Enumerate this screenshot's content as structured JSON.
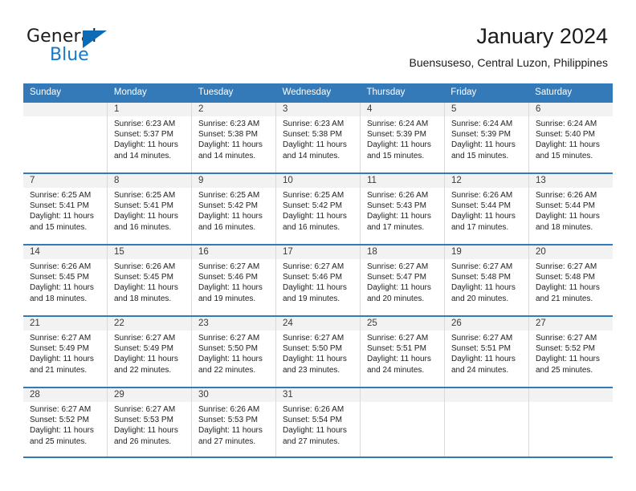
{
  "logo": {
    "word1": "General",
    "word2": "Blue",
    "triangle_color": "#0b6cb5",
    "blue_color": "#1878c8"
  },
  "header": {
    "title": "January 2024",
    "subtitle": "Buensuseso, Central Luzon, Philippines"
  },
  "theme": {
    "header_band": "#357ab8",
    "daynum_band": "#f2f2f2",
    "grid_line": "#d9d9d9"
  },
  "weekdays": [
    "Sunday",
    "Monday",
    "Tuesday",
    "Wednesday",
    "Thursday",
    "Friday",
    "Saturday"
  ],
  "weeks": [
    [
      {
        "day": ""
      },
      {
        "day": "1",
        "sunrise": "Sunrise: 6:23 AM",
        "sunset": "Sunset: 5:37 PM",
        "daylight1": "Daylight: 11 hours",
        "daylight2": "and 14 minutes."
      },
      {
        "day": "2",
        "sunrise": "Sunrise: 6:23 AM",
        "sunset": "Sunset: 5:38 PM",
        "daylight1": "Daylight: 11 hours",
        "daylight2": "and 14 minutes."
      },
      {
        "day": "3",
        "sunrise": "Sunrise: 6:23 AM",
        "sunset": "Sunset: 5:38 PM",
        "daylight1": "Daylight: 11 hours",
        "daylight2": "and 14 minutes."
      },
      {
        "day": "4",
        "sunrise": "Sunrise: 6:24 AM",
        "sunset": "Sunset: 5:39 PM",
        "daylight1": "Daylight: 11 hours",
        "daylight2": "and 15 minutes."
      },
      {
        "day": "5",
        "sunrise": "Sunrise: 6:24 AM",
        "sunset": "Sunset: 5:39 PM",
        "daylight1": "Daylight: 11 hours",
        "daylight2": "and 15 minutes."
      },
      {
        "day": "6",
        "sunrise": "Sunrise: 6:24 AM",
        "sunset": "Sunset: 5:40 PM",
        "daylight1": "Daylight: 11 hours",
        "daylight2": "and 15 minutes."
      }
    ],
    [
      {
        "day": "7",
        "sunrise": "Sunrise: 6:25 AM",
        "sunset": "Sunset: 5:41 PM",
        "daylight1": "Daylight: 11 hours",
        "daylight2": "and 15 minutes."
      },
      {
        "day": "8",
        "sunrise": "Sunrise: 6:25 AM",
        "sunset": "Sunset: 5:41 PM",
        "daylight1": "Daylight: 11 hours",
        "daylight2": "and 16 minutes."
      },
      {
        "day": "9",
        "sunrise": "Sunrise: 6:25 AM",
        "sunset": "Sunset: 5:42 PM",
        "daylight1": "Daylight: 11 hours",
        "daylight2": "and 16 minutes."
      },
      {
        "day": "10",
        "sunrise": "Sunrise: 6:25 AM",
        "sunset": "Sunset: 5:42 PM",
        "daylight1": "Daylight: 11 hours",
        "daylight2": "and 16 minutes."
      },
      {
        "day": "11",
        "sunrise": "Sunrise: 6:26 AM",
        "sunset": "Sunset: 5:43 PM",
        "daylight1": "Daylight: 11 hours",
        "daylight2": "and 17 minutes."
      },
      {
        "day": "12",
        "sunrise": "Sunrise: 6:26 AM",
        "sunset": "Sunset: 5:44 PM",
        "daylight1": "Daylight: 11 hours",
        "daylight2": "and 17 minutes."
      },
      {
        "day": "13",
        "sunrise": "Sunrise: 6:26 AM",
        "sunset": "Sunset: 5:44 PM",
        "daylight1": "Daylight: 11 hours",
        "daylight2": "and 18 minutes."
      }
    ],
    [
      {
        "day": "14",
        "sunrise": "Sunrise: 6:26 AM",
        "sunset": "Sunset: 5:45 PM",
        "daylight1": "Daylight: 11 hours",
        "daylight2": "and 18 minutes."
      },
      {
        "day": "15",
        "sunrise": "Sunrise: 6:26 AM",
        "sunset": "Sunset: 5:45 PM",
        "daylight1": "Daylight: 11 hours",
        "daylight2": "and 18 minutes."
      },
      {
        "day": "16",
        "sunrise": "Sunrise: 6:27 AM",
        "sunset": "Sunset: 5:46 PM",
        "daylight1": "Daylight: 11 hours",
        "daylight2": "and 19 minutes."
      },
      {
        "day": "17",
        "sunrise": "Sunrise: 6:27 AM",
        "sunset": "Sunset: 5:46 PM",
        "daylight1": "Daylight: 11 hours",
        "daylight2": "and 19 minutes."
      },
      {
        "day": "18",
        "sunrise": "Sunrise: 6:27 AM",
        "sunset": "Sunset: 5:47 PM",
        "daylight1": "Daylight: 11 hours",
        "daylight2": "and 20 minutes."
      },
      {
        "day": "19",
        "sunrise": "Sunrise: 6:27 AM",
        "sunset": "Sunset: 5:48 PM",
        "daylight1": "Daylight: 11 hours",
        "daylight2": "and 20 minutes."
      },
      {
        "day": "20",
        "sunrise": "Sunrise: 6:27 AM",
        "sunset": "Sunset: 5:48 PM",
        "daylight1": "Daylight: 11 hours",
        "daylight2": "and 21 minutes."
      }
    ],
    [
      {
        "day": "21",
        "sunrise": "Sunrise: 6:27 AM",
        "sunset": "Sunset: 5:49 PM",
        "daylight1": "Daylight: 11 hours",
        "daylight2": "and 21 minutes."
      },
      {
        "day": "22",
        "sunrise": "Sunrise: 6:27 AM",
        "sunset": "Sunset: 5:49 PM",
        "daylight1": "Daylight: 11 hours",
        "daylight2": "and 22 minutes."
      },
      {
        "day": "23",
        "sunrise": "Sunrise: 6:27 AM",
        "sunset": "Sunset: 5:50 PM",
        "daylight1": "Daylight: 11 hours",
        "daylight2": "and 22 minutes."
      },
      {
        "day": "24",
        "sunrise": "Sunrise: 6:27 AM",
        "sunset": "Sunset: 5:50 PM",
        "daylight1": "Daylight: 11 hours",
        "daylight2": "and 23 minutes."
      },
      {
        "day": "25",
        "sunrise": "Sunrise: 6:27 AM",
        "sunset": "Sunset: 5:51 PM",
        "daylight1": "Daylight: 11 hours",
        "daylight2": "and 24 minutes."
      },
      {
        "day": "26",
        "sunrise": "Sunrise: 6:27 AM",
        "sunset": "Sunset: 5:51 PM",
        "daylight1": "Daylight: 11 hours",
        "daylight2": "and 24 minutes."
      },
      {
        "day": "27",
        "sunrise": "Sunrise: 6:27 AM",
        "sunset": "Sunset: 5:52 PM",
        "daylight1": "Daylight: 11 hours",
        "daylight2": "and 25 minutes."
      }
    ],
    [
      {
        "day": "28",
        "sunrise": "Sunrise: 6:27 AM",
        "sunset": "Sunset: 5:52 PM",
        "daylight1": "Daylight: 11 hours",
        "daylight2": "and 25 minutes."
      },
      {
        "day": "29",
        "sunrise": "Sunrise: 6:27 AM",
        "sunset": "Sunset: 5:53 PM",
        "daylight1": "Daylight: 11 hours",
        "daylight2": "and 26 minutes."
      },
      {
        "day": "30",
        "sunrise": "Sunrise: 6:26 AM",
        "sunset": "Sunset: 5:53 PM",
        "daylight1": "Daylight: 11 hours",
        "daylight2": "and 27 minutes."
      },
      {
        "day": "31",
        "sunrise": "Sunrise: 6:26 AM",
        "sunset": "Sunset: 5:54 PM",
        "daylight1": "Daylight: 11 hours",
        "daylight2": "and 27 minutes."
      },
      {
        "day": ""
      },
      {
        "day": ""
      },
      {
        "day": ""
      }
    ]
  ]
}
